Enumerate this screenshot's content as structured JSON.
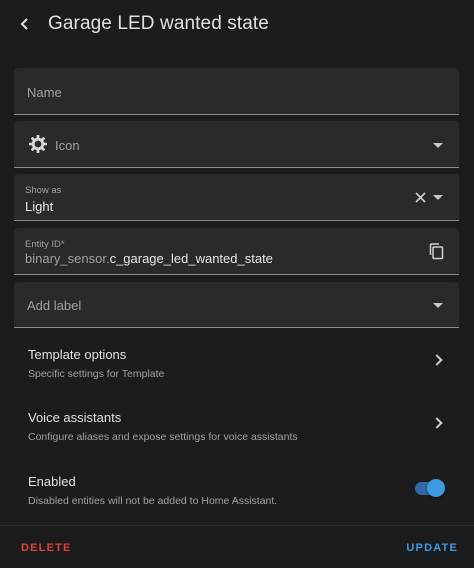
{
  "header": {
    "title": "Garage LED wanted state"
  },
  "name_field": {
    "placeholder": "Name"
  },
  "icon_field": {
    "label": "Icon"
  },
  "show_as": {
    "label": "Show as",
    "value": "Light"
  },
  "entity_id": {
    "label": "Entity ID*",
    "prefix": "binary_sensor.",
    "value": "c_garage_led_wanted_state"
  },
  "label_field": {
    "placeholder": "Add label"
  },
  "template_options": {
    "title": "Template options",
    "subtitle": "Specific settings for Template"
  },
  "voice_assistants": {
    "title": "Voice assistants",
    "subtitle": "Configure aliases and expose settings for voice assistants"
  },
  "enabled": {
    "title": "Enabled",
    "subtitle": "Disabled entities will not be added to Home Assistant.",
    "state": true
  },
  "footer": {
    "delete_label": "DELETE",
    "update_label": "UPDATE"
  },
  "colors": {
    "background": "#1c1c1c",
    "field": "#2a2a2a",
    "accent": "#3d9be6",
    "danger": "#db4437"
  }
}
